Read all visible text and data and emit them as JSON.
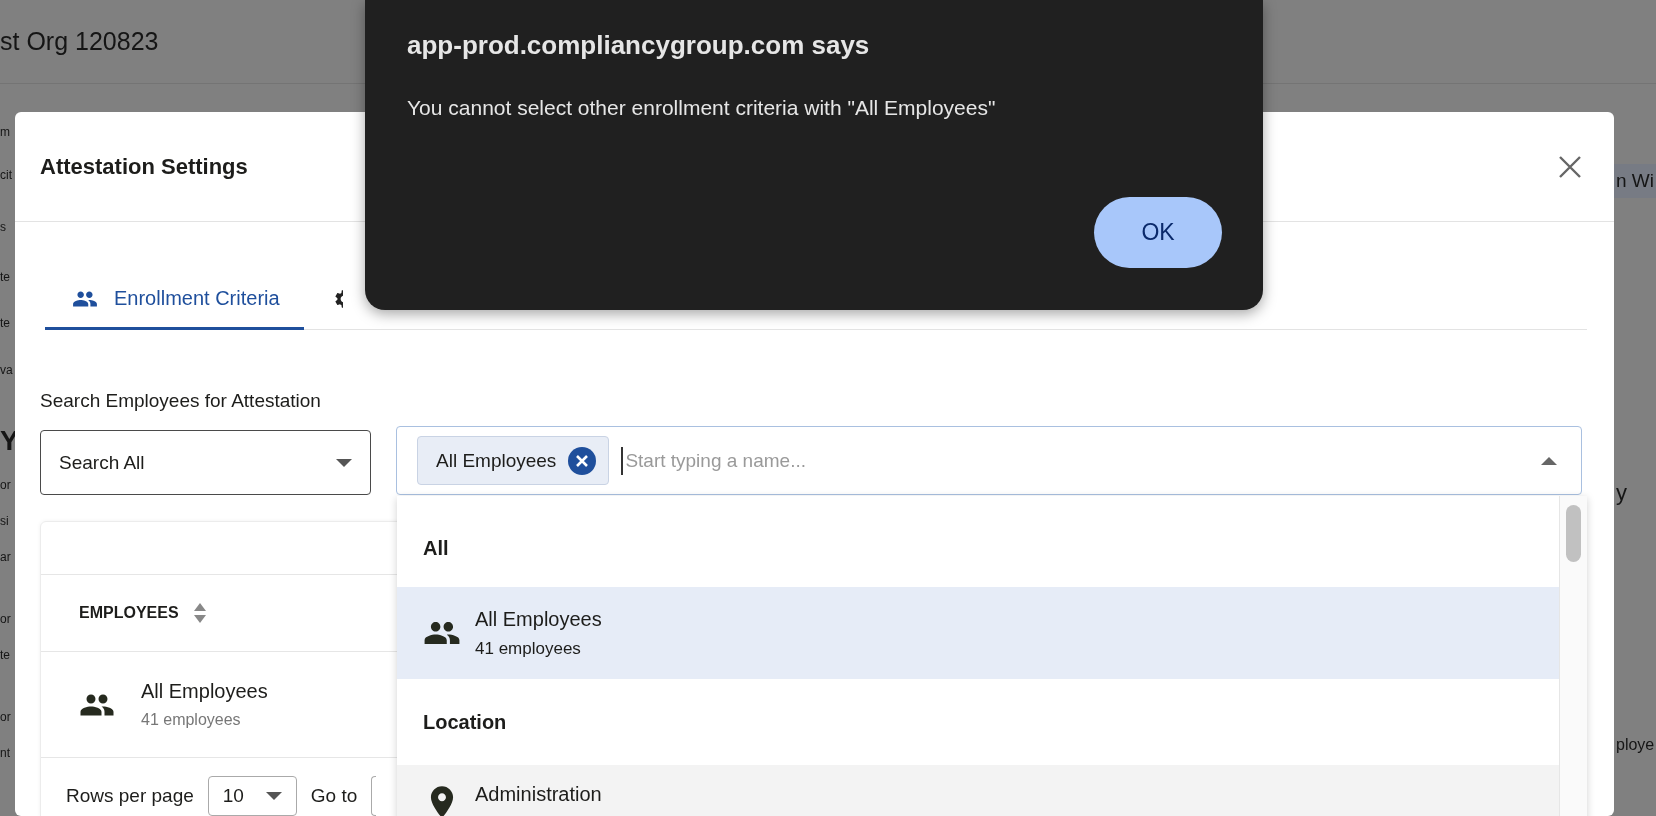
{
  "background": {
    "org_title": "st Org 120823",
    "left_fragments": [
      "m",
      "cit",
      "s",
      "te",
      "te",
      "va",
      "Y",
      "or",
      "si",
      "ar",
      "or",
      "te",
      "or",
      "nt"
    ],
    "right_fragments": [
      "n Wi",
      "y",
      "ploye"
    ]
  },
  "modal": {
    "title": "Attestation Settings",
    "tabs": [
      {
        "label": "Enrollment Criteria",
        "selected": true
      },
      {
        "selected": false
      }
    ],
    "search_label": "Search Employees for Attestation",
    "scope_select": {
      "value": "Search All"
    },
    "criteria_field": {
      "chips": [
        "All Employees"
      ],
      "placeholder": "Start typing a name..."
    },
    "table": {
      "columns": [
        "EMPLOYEES"
      ],
      "rows": [
        {
          "kind": "group",
          "name": "All Employees",
          "detail": "41 employees"
        }
      ],
      "rows_per_page_label": "Rows per page",
      "rows_per_page": "10",
      "goto_label": "Go to"
    },
    "dropdown": {
      "groups": [
        {
          "header": "All",
          "options": [
            {
              "kind": "group",
              "label": "All Employees",
              "detail": "41 employees",
              "selected": true,
              "hovered": false
            }
          ]
        },
        {
          "header": "Location",
          "options": [
            {
              "kind": "location",
              "label": "Administration",
              "selected": false,
              "hovered": true
            }
          ]
        }
      ]
    }
  },
  "alert": {
    "title": "app-prod.compliancygroup.com says",
    "message": "You cannot select other enrollment criteria with \"All Employees\"",
    "buttons": [
      "OK"
    ]
  }
}
